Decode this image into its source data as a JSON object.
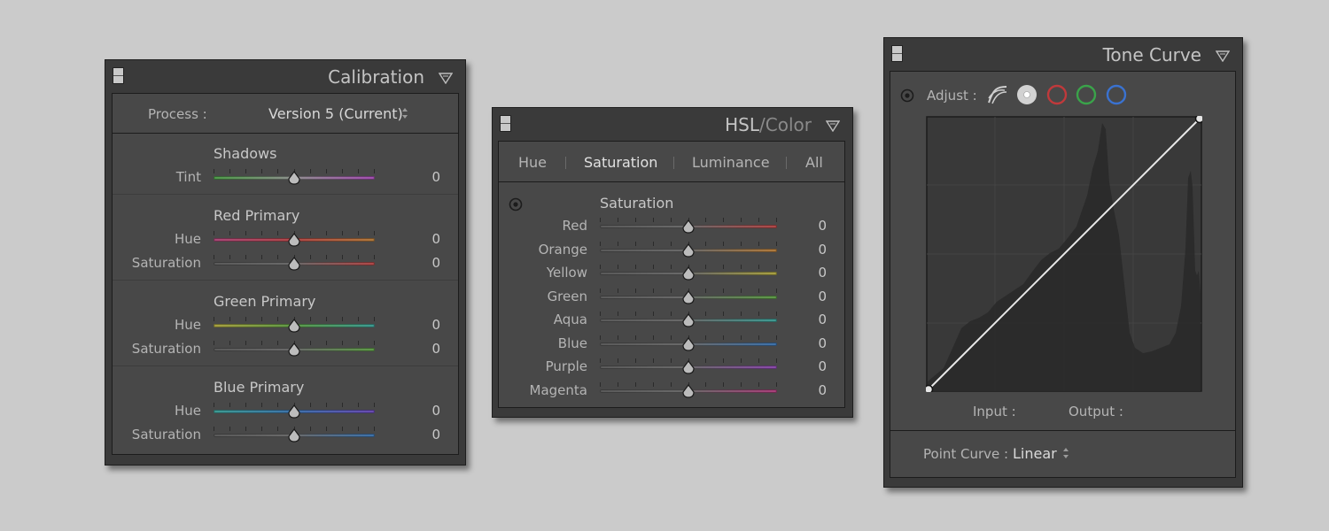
{
  "calibration": {
    "title": "Calibration",
    "process_label": "Process :",
    "process_value": "Version 5 (Current)",
    "shadows": {
      "header": "Shadows",
      "tint_label": "Tint",
      "tint_value": "0"
    },
    "red_primary": {
      "header": "Red Primary",
      "hue_label": "Hue",
      "hue_value": "0",
      "sat_label": "Saturation",
      "sat_value": "0"
    },
    "green_primary": {
      "header": "Green Primary",
      "hue_label": "Hue",
      "hue_value": "0",
      "sat_label": "Saturation",
      "sat_value": "0"
    },
    "blue_primary": {
      "header": "Blue Primary",
      "hue_label": "Hue",
      "hue_value": "0",
      "sat_label": "Saturation",
      "sat_value": "0"
    }
  },
  "hsl": {
    "title_hsl": "HSL",
    "title_slash": "/",
    "title_color": "Color",
    "tabs": [
      "Hue",
      "Saturation",
      "Luminance",
      "All"
    ],
    "active_tab": "Saturation",
    "section_header": "Saturation",
    "rows": [
      {
        "label": "Red",
        "value": "0",
        "color": "#b04848"
      },
      {
        "label": "Orange",
        "value": "0",
        "color": "#b07a3c"
      },
      {
        "label": "Yellow",
        "value": "0",
        "color": "#a8a042"
      },
      {
        "label": "Green",
        "value": "0",
        "color": "#5e9a48"
      },
      {
        "label": "Aqua",
        "value": "0",
        "color": "#3e9a92"
      },
      {
        "label": "Blue",
        "value": "0",
        "color": "#3e72aa"
      },
      {
        "label": "Purple",
        "value": "0",
        "color": "#8a4aaa"
      },
      {
        "label": "Magenta",
        "value": "0",
        "color": "#a8407a"
      }
    ]
  },
  "tone_curve": {
    "title": "Tone Curve",
    "adjust_label": "Adjust :",
    "channel_colors": {
      "red": "#c0393b",
      "green": "#3aa34a",
      "blue": "#3a72d0"
    },
    "input_label": "Input :",
    "output_label": "Output :",
    "point_curve_label": "Point Curve :",
    "point_curve_value": "Linear"
  }
}
